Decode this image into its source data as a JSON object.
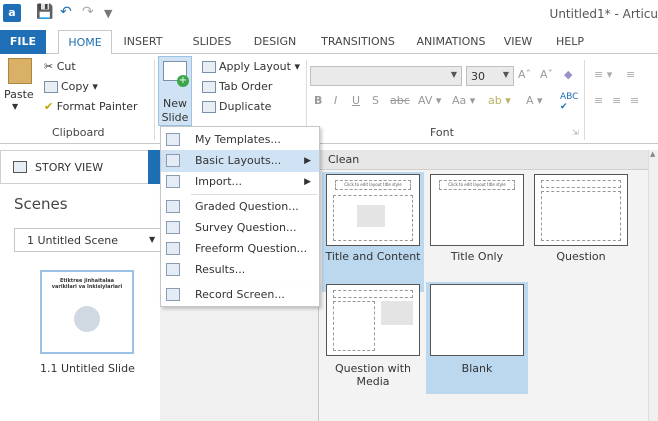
{
  "titlebar": {
    "app_icon": "a",
    "title": "Untitled1* - Articu"
  },
  "tabs": [
    "FILE",
    "HOME",
    "INSERT",
    "SLIDES",
    "DESIGN",
    "TRANSITIONS",
    "ANIMATIONS",
    "VIEW",
    "HELP"
  ],
  "ribbon": {
    "clipboard": {
      "paste": "Paste",
      "cut": "Cut",
      "copy": "Copy",
      "format_painter": "Format Painter",
      "label": "Clipboard"
    },
    "slide": {
      "new_slide_line1": "New",
      "new_slide_line2": "Slide",
      "apply_layout": "Apply Layout",
      "tab_order": "Tab Order",
      "duplicate": "Duplicate"
    },
    "font": {
      "size": "30",
      "label": "Font"
    }
  },
  "left": {
    "story_view": "STORY VIEW",
    "scenes": "Scenes",
    "scene_select": "1 Untitled Scene",
    "slide_thumb_text": "Etiktree jinhaitalaa varikilari va Inkisiylarlari",
    "slide_label": "1.1 Untitled Slide"
  },
  "menu": {
    "items": [
      "My Templates...",
      "Basic Layouts...",
      "Import...",
      "Graded Question...",
      "Survey Question...",
      "Freeform Question...",
      "Results...",
      "Record Screen..."
    ]
  },
  "gallery": {
    "header": "Clean",
    "layouts": [
      "Title and Content",
      "Title Only",
      "Question",
      "Question with Media",
      "Blank"
    ],
    "thumb_title_text": "Click to edit layout title style"
  },
  "colors": {
    "accent": "#1e6fb5",
    "highlight": "#cfe3f5",
    "selected": "#bcd8ef"
  }
}
